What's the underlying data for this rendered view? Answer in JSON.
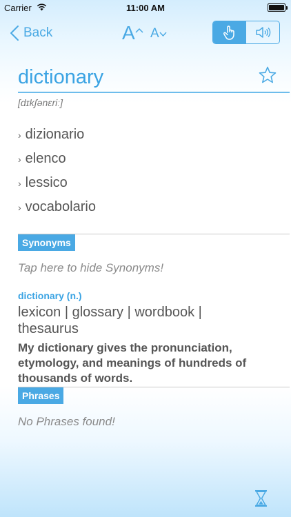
{
  "status_bar": {
    "carrier": "Carrier",
    "time": "11:00 AM"
  },
  "nav": {
    "back_label": "Back",
    "font_increase_letter": "A",
    "font_decrease_letter": "A"
  },
  "entry": {
    "word": "dictionary",
    "phonetic": "[dɪkʃənɛriː]",
    "translations": [
      "dizionario",
      "elenco",
      "lessico",
      "vocabolario"
    ]
  },
  "synonyms": {
    "tag": "Synonyms",
    "hint": "Tap here to hide Synonyms!",
    "part_of_speech": "dictionary (n.)",
    "list": "lexicon | glossary | wordbook | thesaurus",
    "example": "My dictionary gives the pronunciation, etymology, and meanings of hundreds of thousands of words."
  },
  "phrases": {
    "tag": "Phrases",
    "hint": "No Phrases found!"
  },
  "icons": [
    "wifi-icon",
    "battery-icon",
    "back-chevron-icon",
    "font-increase-icon",
    "font-decrease-icon",
    "hand-touch-icon",
    "speaker-icon",
    "star-icon",
    "hourglass-icon"
  ],
  "colors": {
    "accent": "#4aa9e4",
    "text": "#555555",
    "hint": "#8a8a8a"
  }
}
